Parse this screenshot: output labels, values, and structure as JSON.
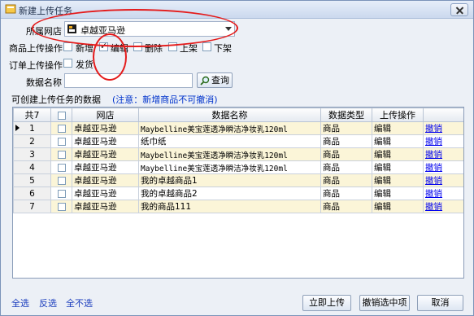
{
  "window": {
    "title": "新建上传任务"
  },
  "form": {
    "shop_label": "所属网店",
    "shop_value": "卓越亚马逊",
    "product_op_label": "商品上传操作",
    "product_ops": [
      {
        "label": "新增",
        "checked": false
      },
      {
        "label": "编辑",
        "checked": true
      },
      {
        "label": "删除",
        "checked": false
      },
      {
        "label": "上架",
        "checked": false
      },
      {
        "label": "下架",
        "checked": false
      }
    ],
    "order_op_label": "订单上传操作",
    "order_ops": [
      {
        "label": "发货",
        "checked": false
      }
    ],
    "data_name_label": "数据名称",
    "data_name_value": "",
    "search_label": "查询"
  },
  "grid_header_text": "可创建上传任务的数据",
  "grid_note": "(注意：新增商品不可撤消)",
  "grid": {
    "columns": [
      "共7",
      "",
      "网店",
      "数据名称",
      "数据类型",
      "上传操作",
      ""
    ],
    "rows": [
      {
        "n": "1",
        "shop": "卓越亚马逊",
        "name": "Maybelline美宝莲透净瞬洁净妆乳120ml",
        "type": "商品",
        "op": "编辑",
        "action": "撤销"
      },
      {
        "n": "2",
        "shop": "卓越亚马逊",
        "name": "纸巾纸",
        "type": "商品",
        "op": "编辑",
        "action": "撤销"
      },
      {
        "n": "3",
        "shop": "卓越亚马逊",
        "name": "Maybelline美宝莲透净瞬洁净妆乳120ml",
        "type": "商品",
        "op": "编辑",
        "action": "撤销"
      },
      {
        "n": "4",
        "shop": "卓越亚马逊",
        "name": "Maybelline美宝莲透净瞬洁净妆乳120ml",
        "type": "商品",
        "op": "编辑",
        "action": "撤销"
      },
      {
        "n": "5",
        "shop": "卓越亚马逊",
        "name": "我的卓越商品1",
        "type": "商品",
        "op": "编辑",
        "action": "撤销"
      },
      {
        "n": "6",
        "shop": "卓越亚马逊",
        "name": "我的卓越商品2",
        "type": "商品",
        "op": "编辑",
        "action": "撤销"
      },
      {
        "n": "7",
        "shop": "卓越亚马逊",
        "name": "我的商品111",
        "type": "商品",
        "op": "编辑",
        "action": "撤销"
      }
    ]
  },
  "footer": {
    "select_all": "全选",
    "invert": "反选",
    "select_none": "全不选",
    "upload_now": "立即上传",
    "undo_selected": "撤销选中项",
    "cancel": "取消"
  },
  "colors": {
    "annotation": "#e41b1b",
    "row_alt": "#fbf5d8",
    "link": "#0000ee"
  }
}
